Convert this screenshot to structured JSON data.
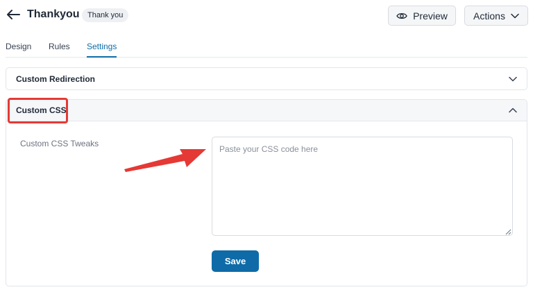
{
  "header": {
    "title": "Thankyou",
    "badge": "Thank you",
    "back_icon": "arrow-left-icon",
    "preview_label": "Preview",
    "preview_icon": "eye-icon",
    "actions_label": "Actions",
    "actions_icon": "chevron-down-icon"
  },
  "tabs": [
    {
      "label": "Design",
      "active": false
    },
    {
      "label": "Rules",
      "active": false
    },
    {
      "label": "Settings",
      "active": true
    }
  ],
  "panels": {
    "custom_redirection": {
      "title": "Custom Redirection",
      "expanded": false,
      "icon": "chevron-down-icon"
    },
    "custom_css": {
      "title": "Custom CSS",
      "expanded": true,
      "icon": "chevron-up-icon",
      "field_label": "Custom CSS Tweaks",
      "placeholder": "Paste your CSS code here",
      "value": "",
      "save_label": "Save"
    }
  },
  "annotation": {
    "highlight_color": "#e53935",
    "arrow_color": "#e53935"
  },
  "colors": {
    "accent": "#0e6ba8",
    "border": "#e2e5e9"
  }
}
